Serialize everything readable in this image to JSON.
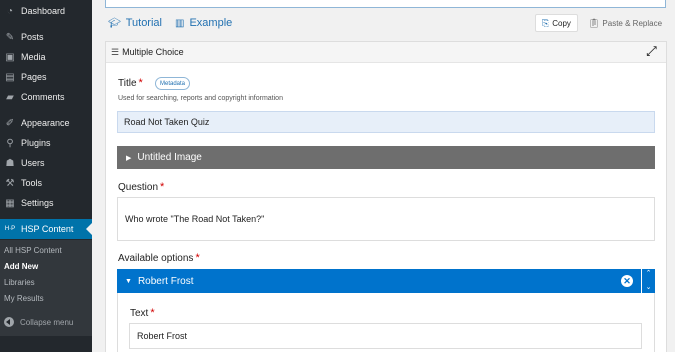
{
  "sidebar": {
    "items": [
      {
        "label": "Dashboard",
        "icon": "dashboard-icon",
        "glyph": "◔"
      },
      {
        "label": "Posts",
        "icon": "pin-icon",
        "glyph": "✎"
      },
      {
        "label": "Media",
        "icon": "media-icon",
        "glyph": "▣"
      },
      {
        "label": "Pages",
        "icon": "pages-icon",
        "glyph": "▤"
      },
      {
        "label": "Comments",
        "icon": "comments-icon",
        "glyph": "▰"
      },
      {
        "label": "Appearance",
        "icon": "brush-icon",
        "glyph": "✐"
      },
      {
        "label": "Plugins",
        "icon": "plug-icon",
        "glyph": "⚲"
      },
      {
        "label": "Users",
        "icon": "user-icon",
        "glyph": "☗"
      },
      {
        "label": "Tools",
        "icon": "wrench-icon",
        "glyph": "⚒"
      },
      {
        "label": "Settings",
        "icon": "settings-icon",
        "glyph": "▦"
      },
      {
        "label": "HSP Content",
        "icon": "h5p-icon",
        "glyph": "H·P"
      }
    ],
    "submenu": [
      {
        "label": "All HSP Content"
      },
      {
        "label": "Add New"
      },
      {
        "label": "Libraries"
      },
      {
        "label": "My Results"
      }
    ],
    "collapse_label": "Collapse menu"
  },
  "toolbar": {
    "tutorial_label": "Tutorial",
    "example_label": "Example",
    "copy_label": "Copy",
    "paste_label": "Paste & Replace"
  },
  "panel": {
    "title": "Multiple Choice",
    "title_label": "Title",
    "metadata_label": "Metadata",
    "title_help": "Used for searching, reports and copyright information",
    "title_value": "Road Not Taken Quiz",
    "image_label": "Untitled Image",
    "question_label": "Question",
    "question_value": "Who wrote \"The Road Not Taken?\"",
    "options_label": "Available options",
    "option_title": "Robert Frost",
    "text_label": "Text",
    "text_value": "Robert Frost"
  },
  "colors": {
    "sidebar_bg": "#23282d",
    "active_bg": "#0073aa",
    "option_bar": "#0073cc",
    "image_bar": "#6e6e6e",
    "required": "#d10000",
    "link": "#2271b1"
  }
}
